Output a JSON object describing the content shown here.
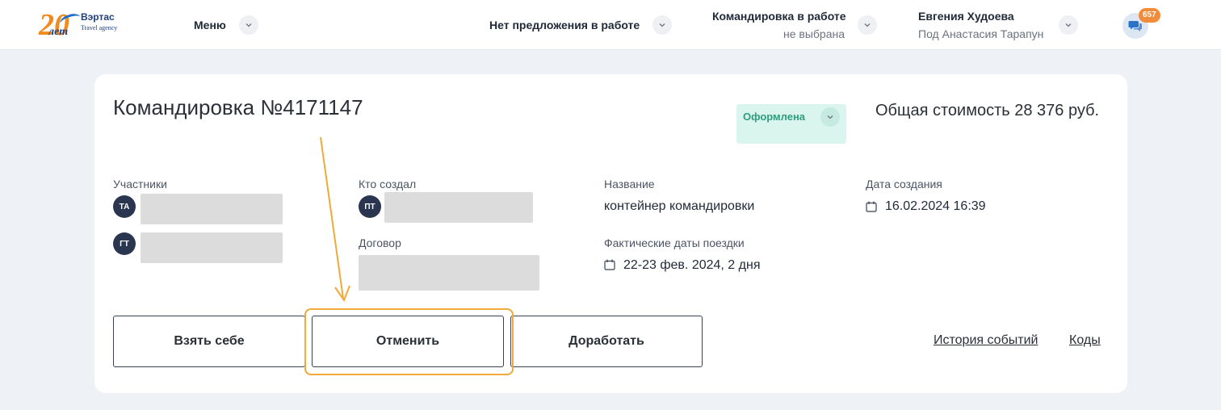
{
  "header": {
    "logo": {
      "number": "20",
      "years": "лет",
      "name": "Вэртас",
      "subtitle": "Travel agency"
    },
    "menu_label": "Меню",
    "offer_label": "Нет предложения в работе",
    "trip": {
      "label": "Командировка в работе",
      "value": "не выбрана"
    },
    "user": {
      "name": "Евгения Худоева",
      "under": "Под Анастасия Тарапун"
    },
    "chat_badge": "657",
    "icons": {
      "chevron": "chevron-down-icon",
      "chat": "chat-bubbles-icon",
      "calendar": "calendar-icon"
    }
  },
  "trip": {
    "title": "Командировка №4171147",
    "status": "Оформлена",
    "total": "Общая стоимость 28 376 руб.",
    "participants_label": "Участники",
    "participants": [
      {
        "initials": "ТА"
      },
      {
        "initials": "ГТ"
      }
    ],
    "creator_label": "Кто создал",
    "creator_initials": "ПТ",
    "contract_label": "Договор",
    "name_label": "Название",
    "name_value": "контейнер командировки",
    "actual_dates_label": "Фактические даты поездки",
    "actual_dates_value": "22-23 фев. 2024, 2 дня",
    "created_label": "Дата создания",
    "created_value": "16.02.2024 16:39"
  },
  "actions": {
    "take": "Взять себе",
    "cancel": "Отменить",
    "rework": "Доработать",
    "history": "История событий",
    "codes": "Коды"
  },
  "colors": {
    "accent_orange": "#f0a93a",
    "status_bg": "#d9f5ee",
    "status_text": "#2e9e7c",
    "avatar": "#2a3550",
    "badge": "#f28b3a"
  }
}
